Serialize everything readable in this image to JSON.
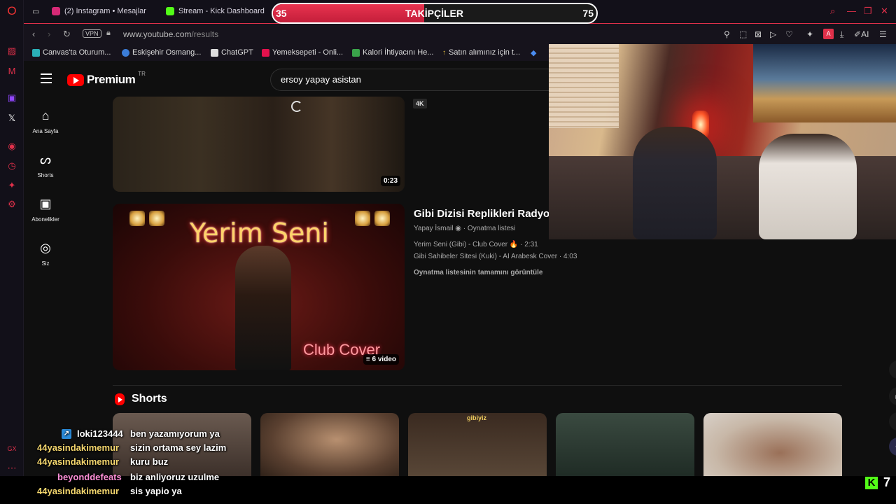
{
  "browser": {
    "tabs": [
      {
        "label": "(2) Instagram • Mesajlar",
        "color": "#d62976"
      },
      {
        "label": "Stream - Kick Dashboard",
        "color": "#53fc18"
      }
    ],
    "url_host": "www.youtube.com",
    "url_path": "/results",
    "vpn_label": "VPN",
    "ai_label": "AI",
    "bookmarks": [
      "Canvas'ta Oturum...",
      "Eskişehir Osmang...",
      "ChatGPT",
      "Yemeksepeti - Onli...",
      "Kalori İhtiyacını He...",
      "Satın alımınız için t..."
    ],
    "gx_label": "GX",
    "accent": "#e0304a"
  },
  "follower_goal": {
    "current": "35",
    "label": "TAKİPÇİLER",
    "target": "75",
    "progress": 0.467
  },
  "youtube": {
    "logo_text": "Premium",
    "region": "TR",
    "search_query": "ersoy yapay asistan",
    "sidebar": [
      {
        "label": "Ana Sayfa",
        "icon": "home-icon"
      },
      {
        "label": "Shorts",
        "icon": "shorts-icon"
      },
      {
        "label": "Abonelikler",
        "icon": "subscriptions-icon"
      },
      {
        "label": "Siz",
        "icon": "account-icon"
      }
    ],
    "video1": {
      "badge": "4K",
      "duration": "0:23"
    },
    "playlist": {
      "title": "Gibi Dizisi Replikleri Radyosu",
      "channel": "Yapay İsmail",
      "type": "Oynatma listesi",
      "items": [
        "Yerim Seni (Gibi) - Club Cover 🔥 · 2:31",
        "Gibi Sahibeler Sitesi (Kuki) - AI Arabesk Cover · 4:03"
      ],
      "full_link": "Oynatma listesinin tamamını görüntüle",
      "video_count": "6 video",
      "thumb_title": "Yerim Seni",
      "thumb_subtitle": "Club Cover"
    },
    "shorts_heading": "Shorts",
    "short_caption": "gibiyiz"
  },
  "chat": [
    {
      "user": "loki123444",
      "message": "ben yazamıyorum ya",
      "color": "#ffffff"
    },
    {
      "user": "44yasindakimemur",
      "message": "sizin ortama sey lazim",
      "color": "#f5d76e"
    },
    {
      "user": "44yasindakimemur",
      "message": "kuru buz",
      "color": "#f5d76e"
    },
    {
      "user": "beyonddefeats",
      "message": "biz anliyoruz uzulme",
      "color": "#ff8fd8"
    },
    {
      "user": "44yasindakimemur",
      "message": "sis yapio ya",
      "color": "#f5d76e"
    }
  ],
  "kick_viewers": "7"
}
